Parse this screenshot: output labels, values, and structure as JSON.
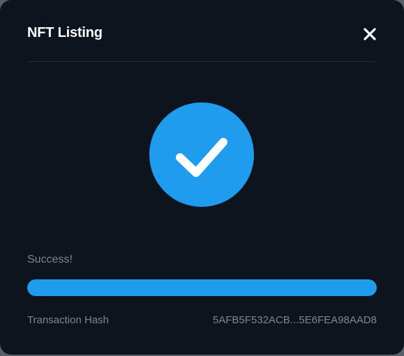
{
  "modal": {
    "title": "NFT Listing",
    "close_icon": "close-icon",
    "status_icon": "checkmark-icon",
    "status_text": "Success!",
    "progress": 1.0,
    "transaction_hash_label": "Transaction Hash",
    "transaction_hash_value": "5AFB5F532ACB...5E6FEA98AAD8"
  },
  "colors": {
    "background": "#0e141d",
    "accent": "#1f9cee",
    "muted_text": "#80858e",
    "title_text": "#ffffff"
  }
}
